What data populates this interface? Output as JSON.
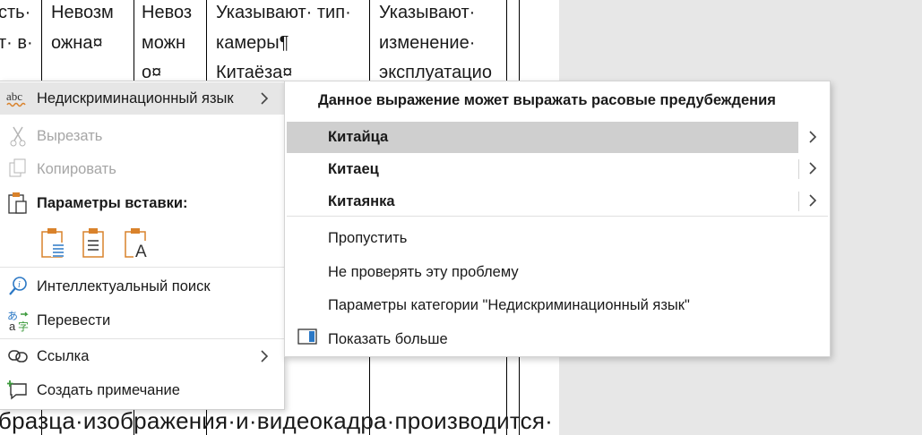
{
  "document": {
    "table_rows": [
      [
        "сть·",
        "Невозм",
        "Невоз",
        "Указывают·  тип·",
        "Указывают·"
      ],
      [
        "т· в·",
        "ожна¤",
        "можн",
        "камеры¶",
        "изменение·"
      ],
      [
        "",
        "",
        "о¤",
        "Китаёза¤",
        "эксплуатацио"
      ]
    ],
    "bottom_text": "бразца·изображения·и·видеокадра·производится·"
  },
  "context_menu": {
    "items": [
      {
        "label": "Недискриминационный язык",
        "icon": "abc-spelling-icon",
        "has_submenu": true,
        "highlighted": true
      },
      {
        "label": "Вырезать",
        "icon": "scissors-icon",
        "disabled": true
      },
      {
        "label": "Копировать",
        "icon": "copy-icon",
        "disabled": true
      },
      {
        "label": "Параметры вставки:",
        "icon": "clipboard-icon"
      },
      {
        "label": "Интеллектуальный поиск",
        "icon": "smart-lookup-icon"
      },
      {
        "label": "Перевести",
        "icon": "translate-icon"
      },
      {
        "label": "Ссылка",
        "icon": "link-icon",
        "has_submenu": true
      },
      {
        "label": "Создать примечание",
        "icon": "new-comment-icon"
      }
    ],
    "paste_options": [
      "paste-keep-formatting-icon",
      "paste-merge-formatting-icon",
      "paste-text-only-icon"
    ]
  },
  "submenu": {
    "heading": "Данное выражение может выражать расовые предубеждения",
    "suggestions": [
      "Китайца",
      "Китаец",
      "Китаянка"
    ],
    "actions": [
      "Пропустить",
      "Не проверять эту проблему",
      "Параметры категории \"Недискриминационный язык\"",
      "Показать больше"
    ]
  },
  "colors": {
    "accent_blue": "#2b78c5",
    "accent_orange": "#d9822b",
    "accent_green": "#3c9a3c",
    "highlight": "#e6e6e6"
  }
}
